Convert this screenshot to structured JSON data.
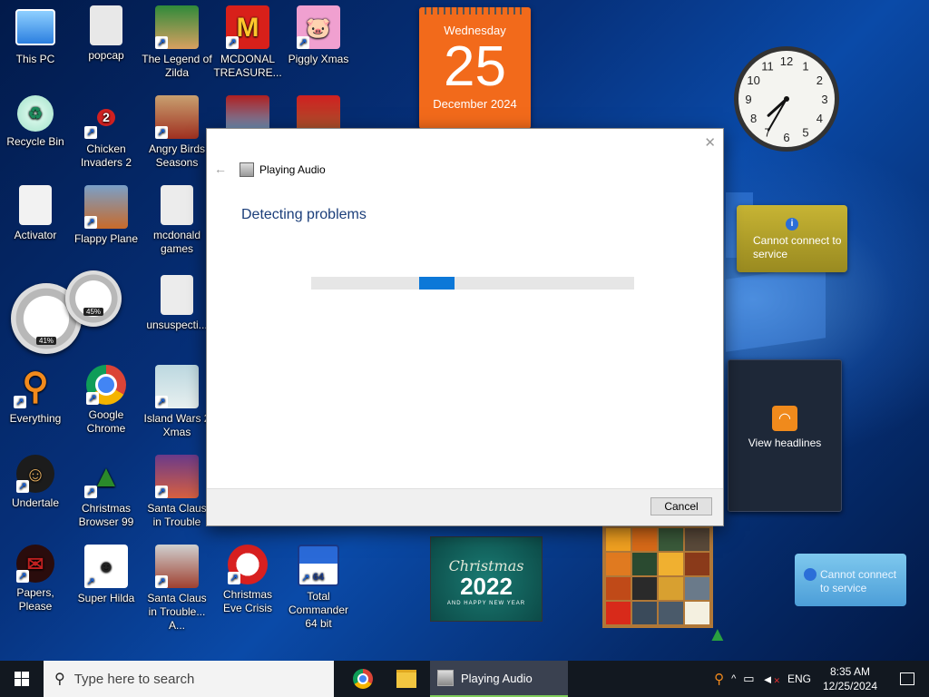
{
  "desktop": {
    "icons": [
      {
        "label": "This PC"
      },
      {
        "label": "popcap"
      },
      {
        "label": "The Legend of Zilda"
      },
      {
        "label": "MCDONAL TREASURE..."
      },
      {
        "label": "Piggly Xmas"
      },
      {
        "label": "Recycle Bin"
      },
      {
        "label": "Chicken Invaders 2"
      },
      {
        "label": "Angry Birds Seasons"
      },
      {
        "label": "Activator"
      },
      {
        "label": "Flappy Plane"
      },
      {
        "label": "mcdonald games"
      },
      {
        "label": "unsuspecti..."
      },
      {
        "label": "Everything"
      },
      {
        "label": "Google Chrome"
      },
      {
        "label": "Island Wars 2 Xmas"
      },
      {
        "label": "Undertale"
      },
      {
        "label": "Christmas Browser 99"
      },
      {
        "label": "Santa Claus in Trouble"
      },
      {
        "label": "Papers, Please"
      },
      {
        "label": "Super Hilda"
      },
      {
        "label": "Santa Claus in Trouble... A..."
      },
      {
        "label": "Christmas Eve Crisis"
      },
      {
        "label": "Total Commander 64 bit"
      }
    ]
  },
  "gadgets": {
    "calendar": {
      "weekday": "Wednesday",
      "day": "25",
      "month_year": "December 2024"
    },
    "weather": {
      "message": "Cannot connect to service"
    },
    "headlines": {
      "label": "View headlines"
    },
    "service2": {
      "message": "Cannot connect to service"
    },
    "cpu_meter": {
      "cpu": "41%",
      "mem": "45%"
    },
    "xmas_card": {
      "line1": "Christmas",
      "year": "2022",
      "line3": "AND HAPPY NEW YEAR"
    },
    "clock": {
      "hour": 7,
      "minute": 35
    }
  },
  "dialog": {
    "title": "Playing Audio",
    "heading": "Detecting problems",
    "cancel_label": "Cancel"
  },
  "taskbar": {
    "search_placeholder": "Type here to search",
    "active_app": "Playing Audio",
    "language": "ENG",
    "time": "8:35 AM",
    "date": "12/25/2024"
  },
  "colors": {
    "accent": "#0c78d8",
    "calendar": "#f26a1b",
    "dialog_heading": "#1b3e7a"
  }
}
